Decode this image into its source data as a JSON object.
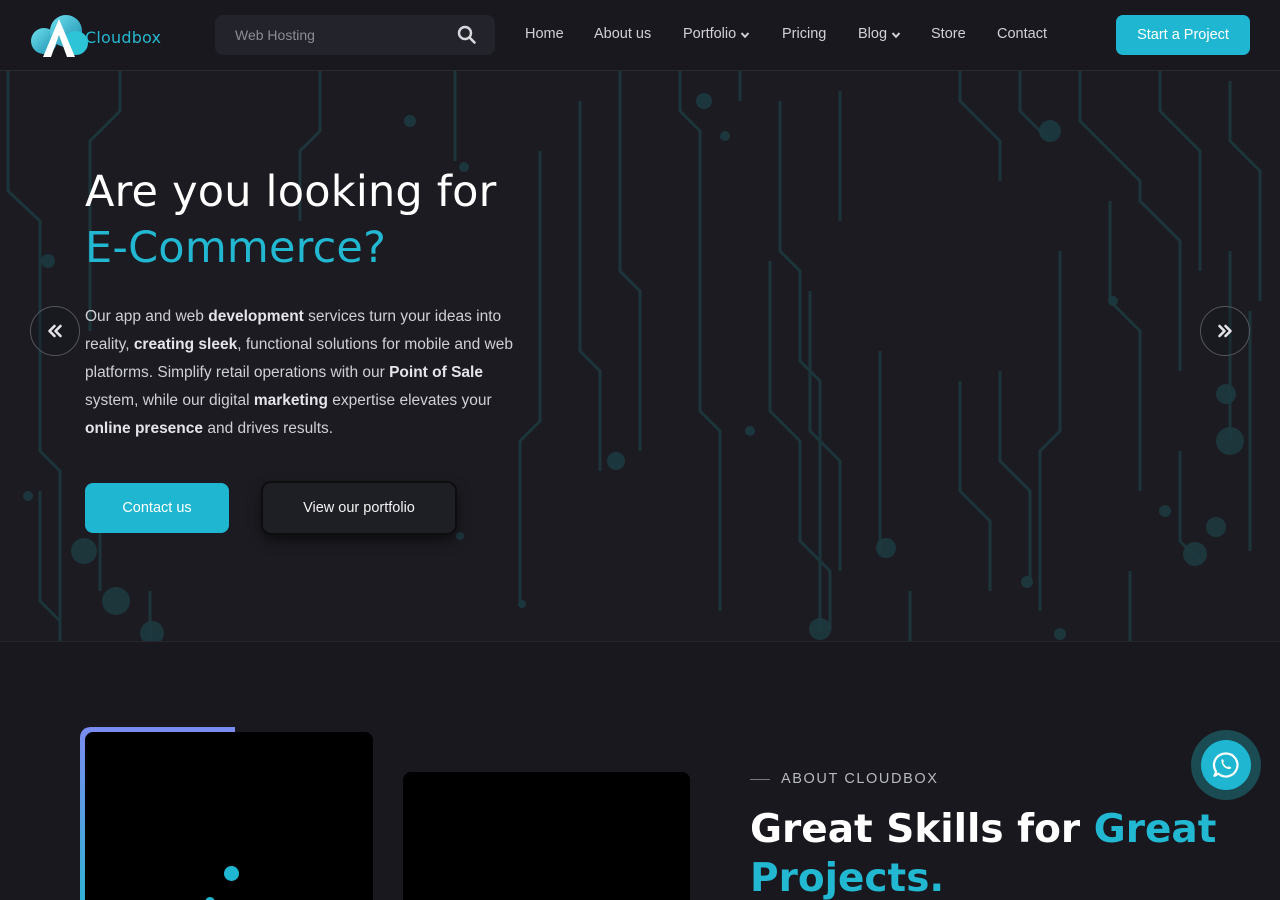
{
  "header": {
    "logo_text": "Cloudbox",
    "search_placeholder": "Web Hosting",
    "nav": [
      {
        "label": "Home"
      },
      {
        "label": "About us"
      },
      {
        "label": "Portfolio"
      },
      {
        "label": "Pricing"
      },
      {
        "label": "Blog"
      },
      {
        "label": "Store"
      },
      {
        "label": "Contact"
      }
    ],
    "cta_label": "Start a Project"
  },
  "hero": {
    "title": "Are you looking for",
    "title_accent": "E-Commerce?",
    "description": [
      {
        "text": "Our app and web ",
        "bold": false
      },
      {
        "text": "development",
        "bold": true
      },
      {
        "text": " services turn your ideas into reality, ",
        "bold": false
      },
      {
        "text": "creating sleek",
        "bold": true
      },
      {
        "text": ", functional solutions for mobile and web platforms. Simplify retail operations with our ",
        "bold": false
      },
      {
        "text": "Point of Sale",
        "bold": true
      },
      {
        "text": " system, while our digital ",
        "bold": false
      },
      {
        "text": "marketing",
        "bold": true
      },
      {
        "text": " expertise elevates your ",
        "bold": false
      },
      {
        "text": "online presence",
        "bold": true
      },
      {
        "text": " and drives results.",
        "bold": false
      }
    ],
    "primary_button": "Contact us",
    "secondary_button": "View our portfolio"
  },
  "about": {
    "label": "ABOUT CLOUDBOX",
    "title": "Great Skills for",
    "title_accent": "Great Projects."
  },
  "colors": {
    "accent": "#1fb6d1",
    "background": "#18181e",
    "hero_background": "#1b1b21"
  },
  "icons": {
    "search": "search-icon",
    "prev": "double-chevron-left-icon",
    "next": "double-chevron-right-icon",
    "whatsapp": "whatsapp-icon"
  }
}
